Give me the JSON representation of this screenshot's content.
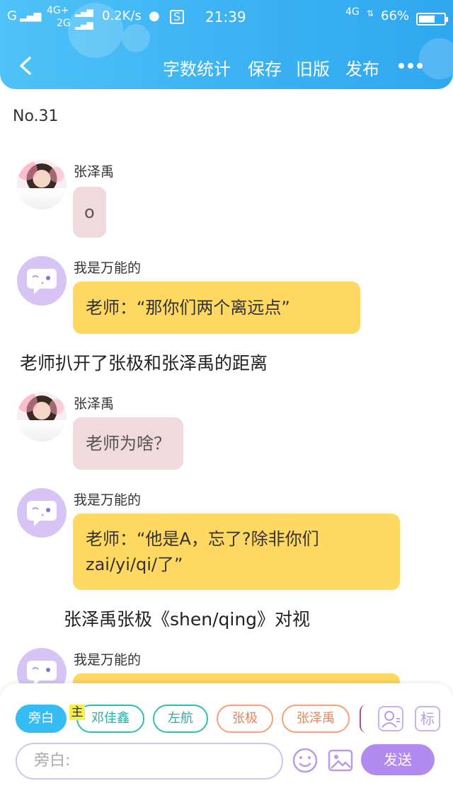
{
  "status_bar": {
    "carrier1": "G",
    "net1": "4G+",
    "net2": "2G",
    "speed": "0.2K/s",
    "time": "21:39",
    "net3": "4G",
    "battery": "66%",
    "battery_level": 0.66
  },
  "nav": {
    "word_count": "字数统计",
    "save": "保存",
    "old_version": "旧版",
    "publish": "发布"
  },
  "chapter": "No.31",
  "messages": [
    {
      "type": "chat",
      "avatar": "photo",
      "name": "张泽禹",
      "text": "o",
      "color": "pink"
    },
    {
      "type": "chat",
      "avatar": "purple",
      "name": "我是万能的",
      "text": "老师：“那你们两个离远点”",
      "color": "yellow"
    },
    {
      "type": "narration",
      "text": "老师扒开了张极和张泽禹的距离"
    },
    {
      "type": "chat",
      "avatar": "photo",
      "name": "张泽禹",
      "text": "老师为啥？",
      "color": "pink"
    },
    {
      "type": "chat",
      "avatar": "purple",
      "name": "我是万能的",
      "text_line1": "老师：“他是A，忘了?除非你们",
      "text_line2": "zai/yi/qi/了”",
      "color": "yellow"
    },
    {
      "type": "narration",
      "text": "张泽禹张极《shen/qing》对视"
    },
    {
      "type": "chat",
      "avatar": "purple",
      "name": "我是万能的",
      "color": "yellow"
    }
  ],
  "panel": {
    "roles": [
      "旁白",
      "邓佳鑫",
      "左航",
      "张极",
      "张泽禹"
    ],
    "lead_mark": "主",
    "tag_button": "标",
    "input_placeholder": "旁白:",
    "send": "发送"
  }
}
